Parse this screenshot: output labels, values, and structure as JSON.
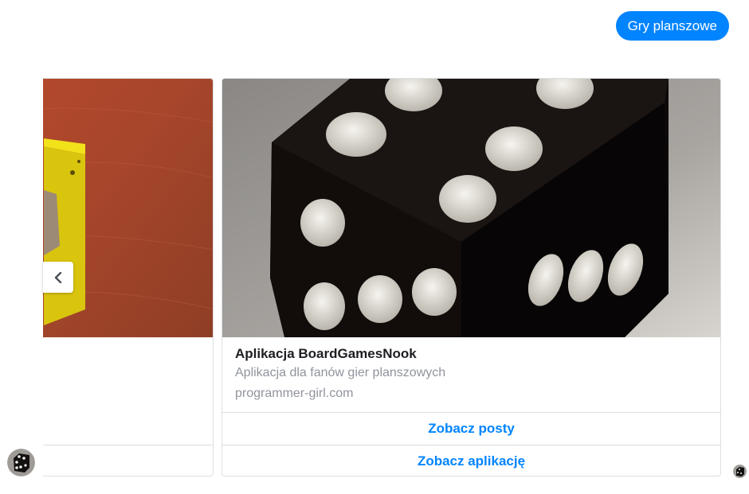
{
  "message": {
    "text": "Gry planszowe"
  },
  "carousel": {
    "cards": [
      {
        "title": "Aplikacja BoardGamesNook",
        "subtitle": "Aplikacja dla fanów gier planszowych",
        "url": "programmer-girl.com",
        "buttons": [
          "Zobacz posty",
          "Zobacz aplikację"
        ]
      }
    ]
  },
  "colors": {
    "accent": "#0084ff",
    "text_primary": "#1c1e21",
    "text_secondary": "#90949c",
    "border": "#dddfe2"
  },
  "icons": {
    "prev": "chevron-left-icon",
    "avatar": "dice-avatar"
  }
}
